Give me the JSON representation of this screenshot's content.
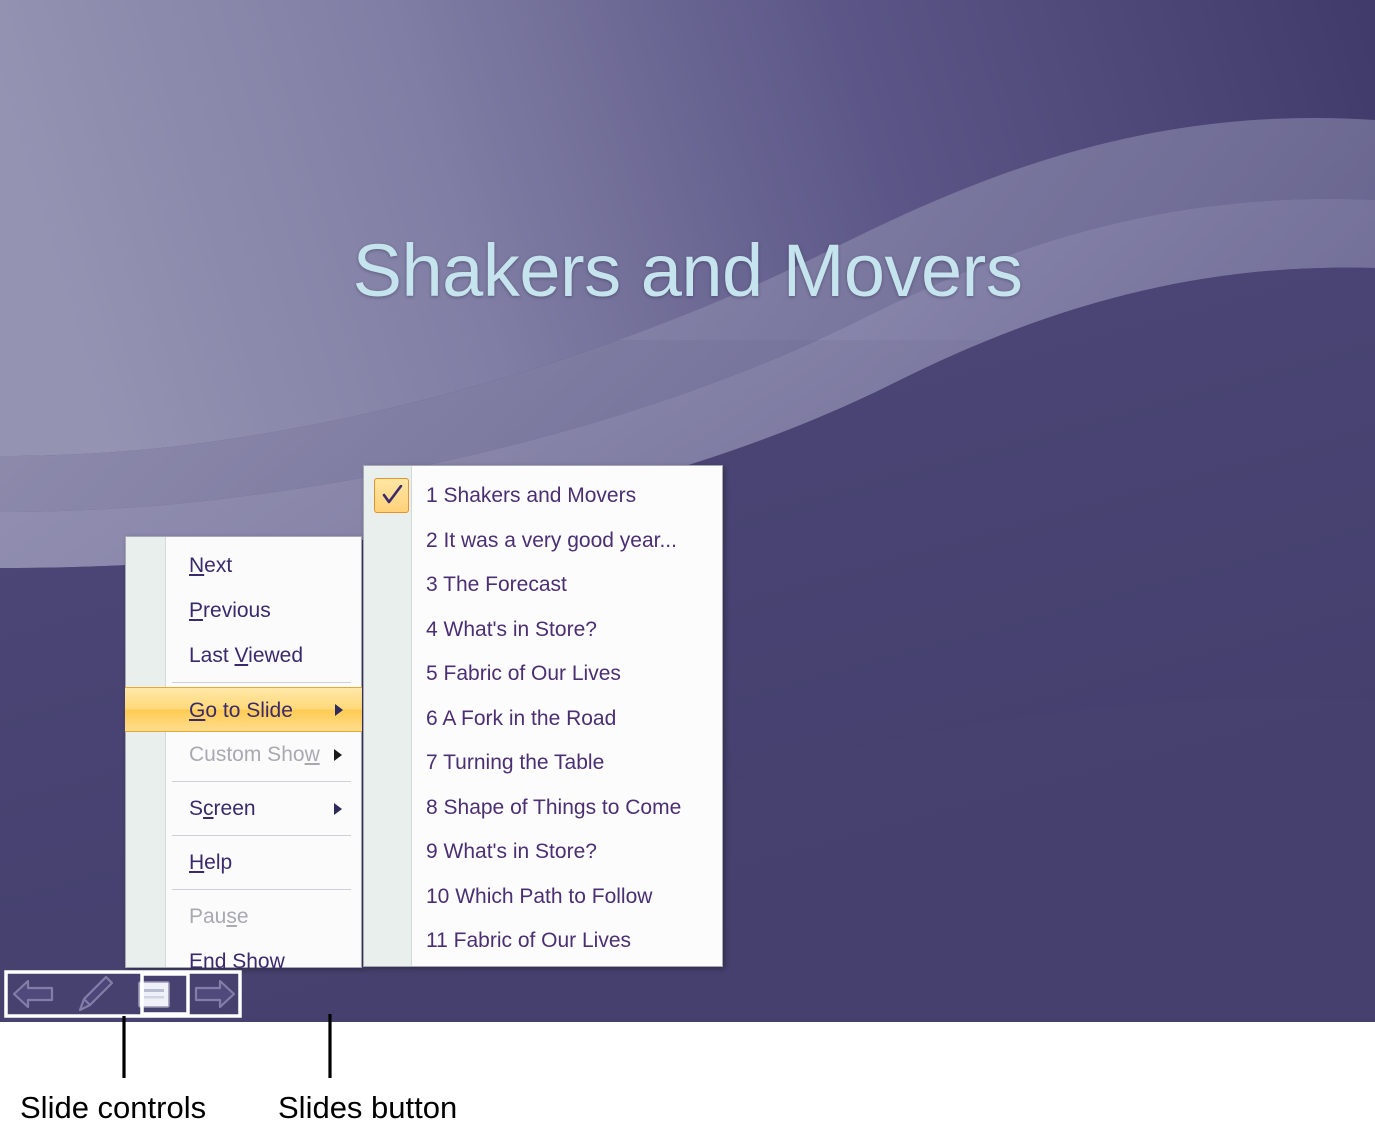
{
  "slide": {
    "title": "Shakers and Movers",
    "title_color": "#c6e4ed",
    "background_dark": "#474270",
    "background_light": "#8b89ab"
  },
  "context_menu": {
    "accent_highlight_color": "#ffd97a",
    "items": [
      {
        "label": "Next",
        "accel": "N",
        "state": "normal",
        "submenu": false
      },
      {
        "label": "Previous",
        "accel": "P",
        "state": "normal",
        "submenu": false
      },
      {
        "label": "Last Viewed",
        "accel": "V",
        "state": "normal",
        "submenu": false
      },
      {
        "label": "Go to Slide",
        "accel": "G",
        "state": "highlight",
        "submenu": true
      },
      {
        "label": "Custom Show",
        "accel": "w",
        "state": "disabled",
        "submenu": true
      },
      {
        "label": "Screen",
        "accel": "c",
        "state": "normal",
        "submenu": true
      },
      {
        "label": "Help",
        "accel": "H",
        "state": "normal",
        "submenu": false
      },
      {
        "label": "Pause",
        "accel": "s",
        "state": "disabled",
        "submenu": false
      },
      {
        "label": "End Show",
        "accel": "E",
        "state": "normal",
        "submenu": false
      }
    ]
  },
  "go_to_slide_submenu": {
    "checked_index": 0,
    "items": [
      "1 Shakers and Movers",
      "2 It was a very good year...",
      "3 The Forecast",
      "4 What's in Store?",
      "5 Fabric of Our Lives",
      "6 A Fork in the Road",
      "7 Turning the Table",
      "8 Shape of Things to Come",
      "9 What's in Store?",
      "10 Which Path to Follow",
      "11 Fabric of Our Lives"
    ]
  },
  "toolbar": {
    "prev_label": "Previous",
    "pen_label": "Pen",
    "slides_label": "Slides",
    "next_label": "Next"
  },
  "callouts": {
    "slide_controls": "Slide controls",
    "slides_button": "Slides button"
  }
}
